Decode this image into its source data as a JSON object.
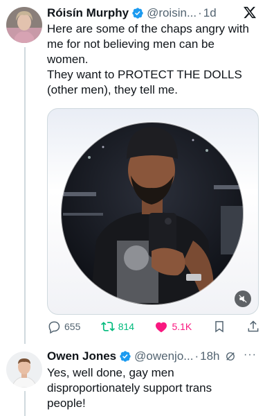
{
  "tweet1": {
    "display_name": "Róisín Murphy",
    "handle": "@roisin...",
    "separator": "·",
    "time": "1d",
    "text_lines": [
      "Here are some of the chaps angry with me for not believing men can be women.",
      "They want to PROTECT THE DOLLS (other men), they tell me."
    ],
    "stats": {
      "replies": "655",
      "retweets": "814",
      "likes": "5.1K"
    }
  },
  "tweet2": {
    "display_name": "Owen Jones",
    "handle": "@owenjo...",
    "separator": "·",
    "time": "18h",
    "more": "···",
    "text": "Yes, well done, gay men disproportionately support trans people!"
  },
  "colors": {
    "verified": "#1d9bf0",
    "retweet": "#00ba7c",
    "like": "#f91880",
    "muted_text": "#536471"
  },
  "icons": {
    "close": "x-logo-icon",
    "verified": "verified-badge-icon",
    "reply": "reply-icon",
    "retweet": "retweet-icon",
    "like": "heart-icon",
    "bookmark": "bookmark-icon",
    "share": "share-icon",
    "mute": "mute-icon",
    "grok": "grok-icon"
  }
}
